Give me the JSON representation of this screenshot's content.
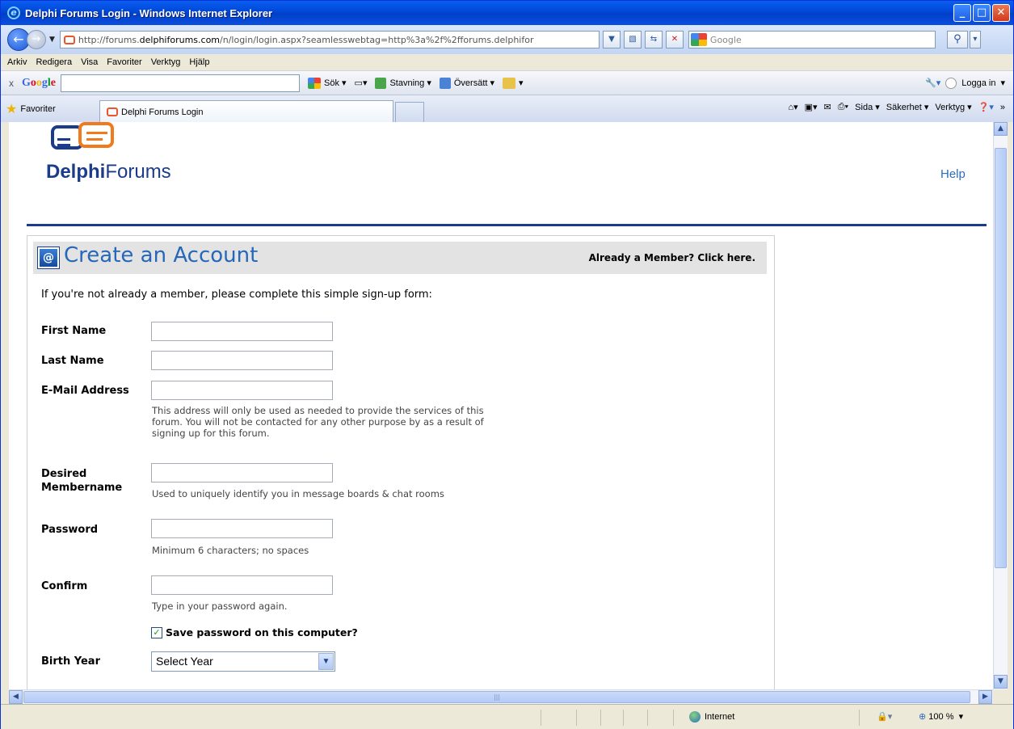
{
  "window": {
    "title": "Delphi Forums Login - Windows Internet Explorer"
  },
  "nav": {
    "url_prefix": "http://forums.",
    "url_domain": "delphiforums.com",
    "url_rest": "/n/login/login.aspx?seamlesswebtag=http%3a%2f%2fforums.delphifor",
    "search_engine": "Google"
  },
  "menu": [
    "Arkiv",
    "Redigera",
    "Visa",
    "Favoriter",
    "Verktyg",
    "Hjälp"
  ],
  "google_toolbar": {
    "close": "x",
    "logo": "Google",
    "search_label": "Sök",
    "spell_label": "Stavning",
    "translate_label": "Översätt",
    "login_label": "Logga in"
  },
  "favbar": {
    "favorites_label": "Favoriter",
    "tab_title": "Delphi Forums Login",
    "page_label": "Sida",
    "security_label": "Säkerhet",
    "tools_label": "Verktyg"
  },
  "page": {
    "logo_bold": "Delphi",
    "logo_rest": "Forums",
    "help_link": "Help",
    "header_title": "Create an Account",
    "already_member": "Already a Member? Click here.",
    "intro": "If you're not already a member, please complete this simple sign-up form:",
    "fields": {
      "first_name": "First Name",
      "last_name": "Last Name",
      "email": "E-Mail Address",
      "email_hint_1": "This address will only be used as needed to provide the services of this",
      "email_hint_2": "forum. You will not be contacted for any other purpose by as a result of",
      "email_hint_3": "signing up for this forum.",
      "member_1": "Desired",
      "member_2": "Membername",
      "member_hint": "Used to uniquely identify you in message boards & chat rooms",
      "password": "Password",
      "password_hint": "Minimum 6 characters; no spaces",
      "confirm": "Confirm",
      "confirm_hint": "Type in your password again.",
      "save_password": "Save password on this computer?",
      "birth_year": "Birth Year",
      "birth_year_selected": "Select Year"
    }
  },
  "status": {
    "zone": "Internet",
    "zoom": "100 %"
  }
}
